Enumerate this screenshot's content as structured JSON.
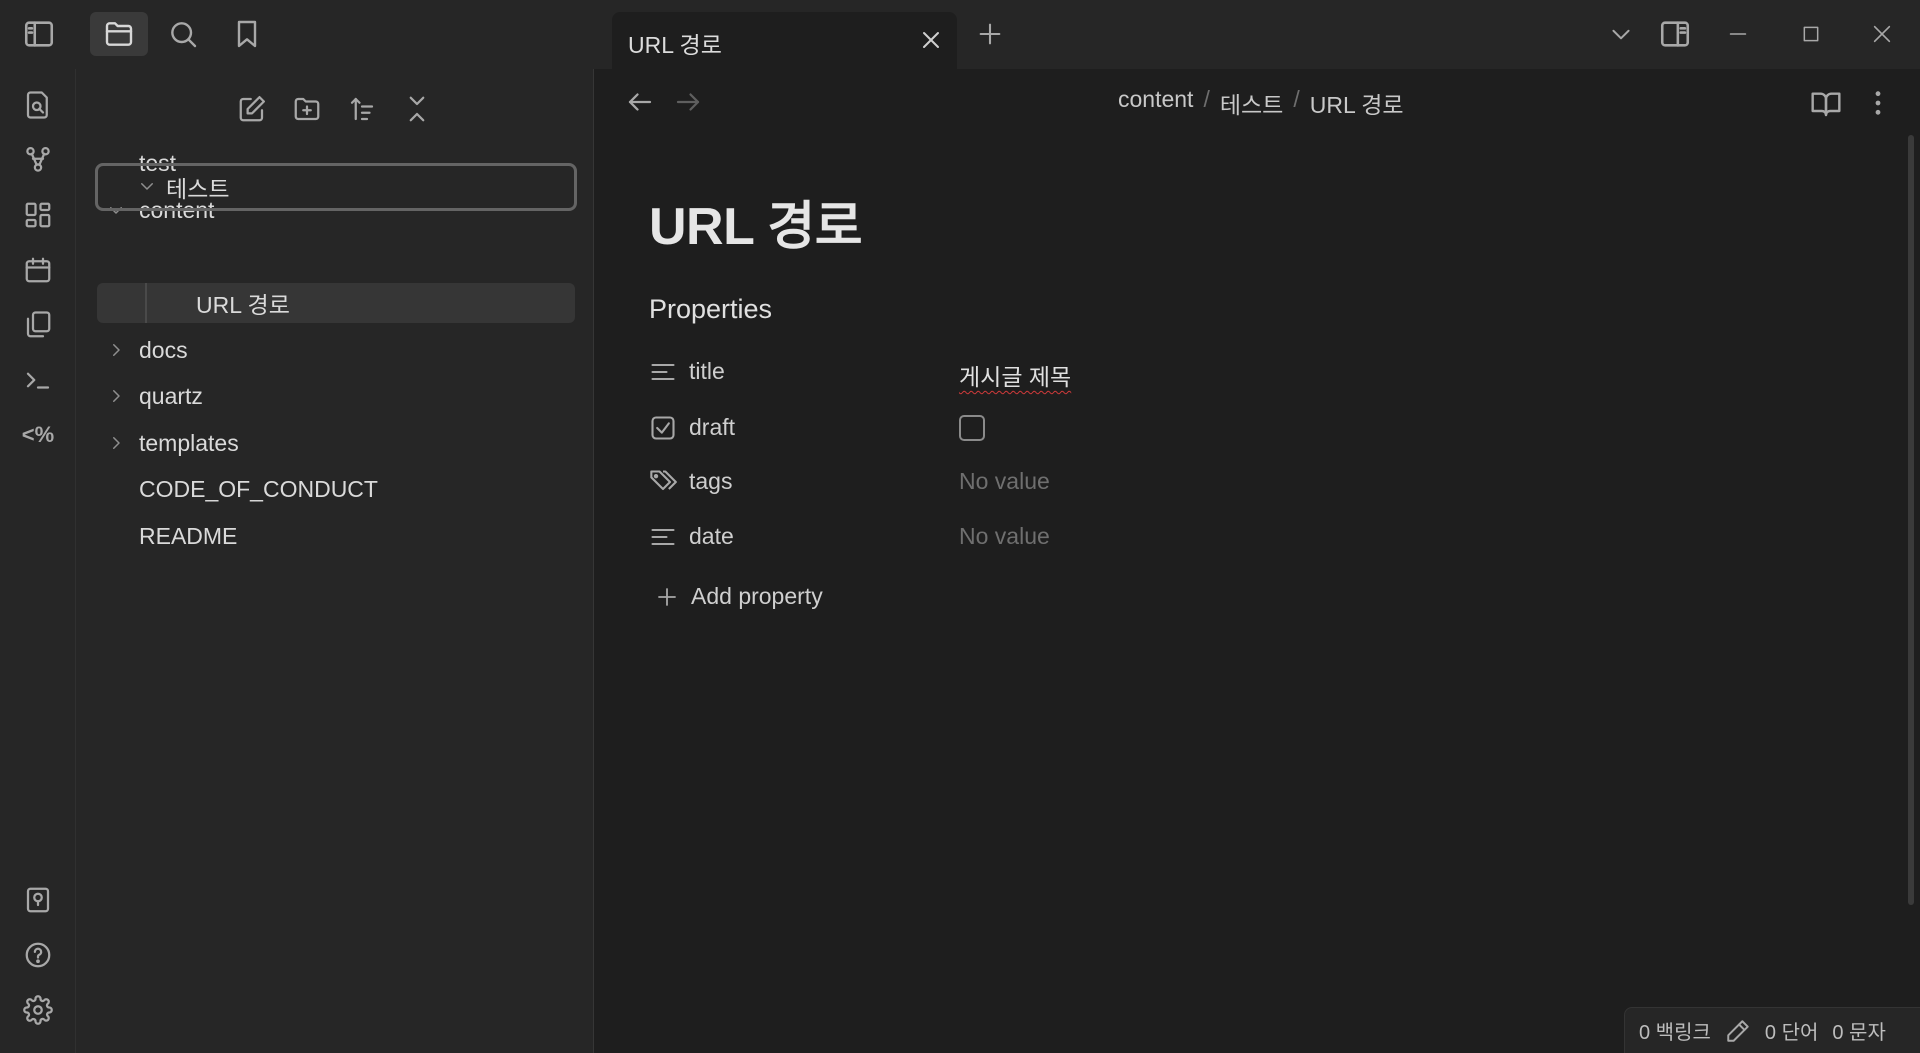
{
  "titlebar": {
    "tab_label": "URL 경로",
    "icons": [
      "sidebar-toggle-icon",
      "folder-icon",
      "search-icon",
      "bookmark-icon",
      "plus-icon",
      "chevron-down-icon",
      "split-pane-icon",
      "minimize-icon",
      "maximize-icon",
      "close-icon"
    ]
  },
  "ribbon": {
    "top_icons": [
      "quick-switch-icon",
      "graph-icon",
      "canvas-icon",
      "calendar-icon",
      "copy-icon",
      "terminal-icon",
      "templater-icon"
    ],
    "templater_label": "<%",
    "bottom_icons": [
      "vault-icon",
      "help-icon",
      "settings-icon"
    ]
  },
  "sidebar": {
    "toolbar_icons": [
      "new-note-icon",
      "new-folder-icon",
      "sort-icon",
      "collapse-all-icon"
    ],
    "tree": {
      "test": "test",
      "content": "content",
      "folder_test": "테스트",
      "file_url": "URL 경로",
      "docs": "docs",
      "quartz": "quartz",
      "templates": "templates",
      "code_of_conduct": "CODE_OF_CONDUCT",
      "readme": "README"
    }
  },
  "main": {
    "breadcrumb": [
      "content",
      "테스트",
      "URL 경로"
    ],
    "breadcrumb_sep": "/",
    "note_title": "URL 경로",
    "properties_heading": "Properties",
    "properties": [
      {
        "key": "title",
        "value": "게시글 제목",
        "icon": "text-lines-icon"
      },
      {
        "key": "draft",
        "value": "",
        "icon": "checkbox-icon",
        "checked": false
      },
      {
        "key": "tags",
        "value": "No value",
        "icon": "tags-icon"
      },
      {
        "key": "date",
        "value": "No value",
        "icon": "text-lines-icon"
      }
    ],
    "add_property_label": "Add property"
  },
  "statusbar": {
    "backlinks": "0 백링크",
    "words": "0 단어",
    "chars": "0 문자"
  }
}
